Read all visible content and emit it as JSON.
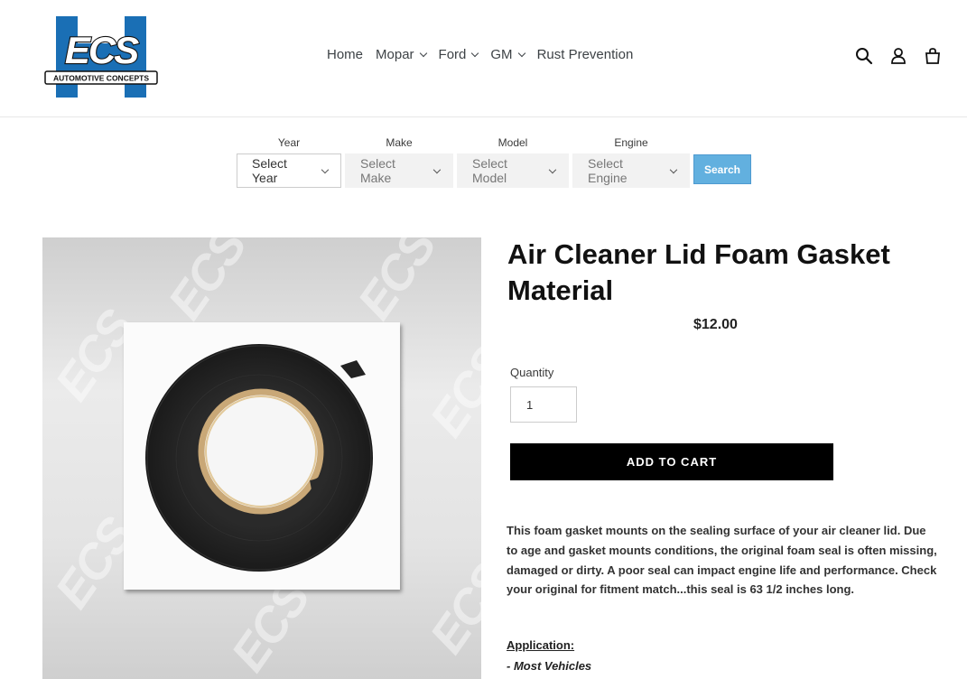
{
  "brand": {
    "logo_text": "ECS",
    "logo_subtext": "AUTOMOTIVE CONCEPTS",
    "colors": {
      "blue": "#1a6fb5",
      "dark": "#1a1a1a"
    }
  },
  "nav": {
    "items": [
      {
        "label": "Home",
        "has_dropdown": false
      },
      {
        "label": "Mopar",
        "has_dropdown": true
      },
      {
        "label": "Ford",
        "has_dropdown": true
      },
      {
        "label": "GM",
        "has_dropdown": true
      },
      {
        "label": "Rust Prevention",
        "has_dropdown": false
      }
    ]
  },
  "header_icons": [
    "search-icon",
    "account-icon",
    "cart-icon"
  ],
  "filter": {
    "year": {
      "label": "Year",
      "value": "Select Year"
    },
    "make": {
      "label": "Make",
      "value": "Select Make"
    },
    "model": {
      "label": "Model",
      "value": "Select Model"
    },
    "engine": {
      "label": "Engine",
      "value": "Select Engine"
    },
    "search_label": "Search",
    "search_color": "#62b0df"
  },
  "product": {
    "title": "Air Cleaner Lid Foam Gasket Material",
    "price": "$12.00",
    "quantity_label": "Quantity",
    "quantity_value": "1",
    "add_to_cart": "ADD TO CART",
    "description": "This foam gasket mounts on the sealing surface of your air cleaner lid. Due to age and gasket mounts conditions, the original foam seal is often missing, damaged or dirty.  A poor seal can impact engine life and performance.  Check your original for fitment match...this seal is 63 1/2 inches long.",
    "application_heading": "Application:",
    "application_items": [
      "-  Most Vehicles"
    ],
    "image_watermark": "ECS"
  }
}
